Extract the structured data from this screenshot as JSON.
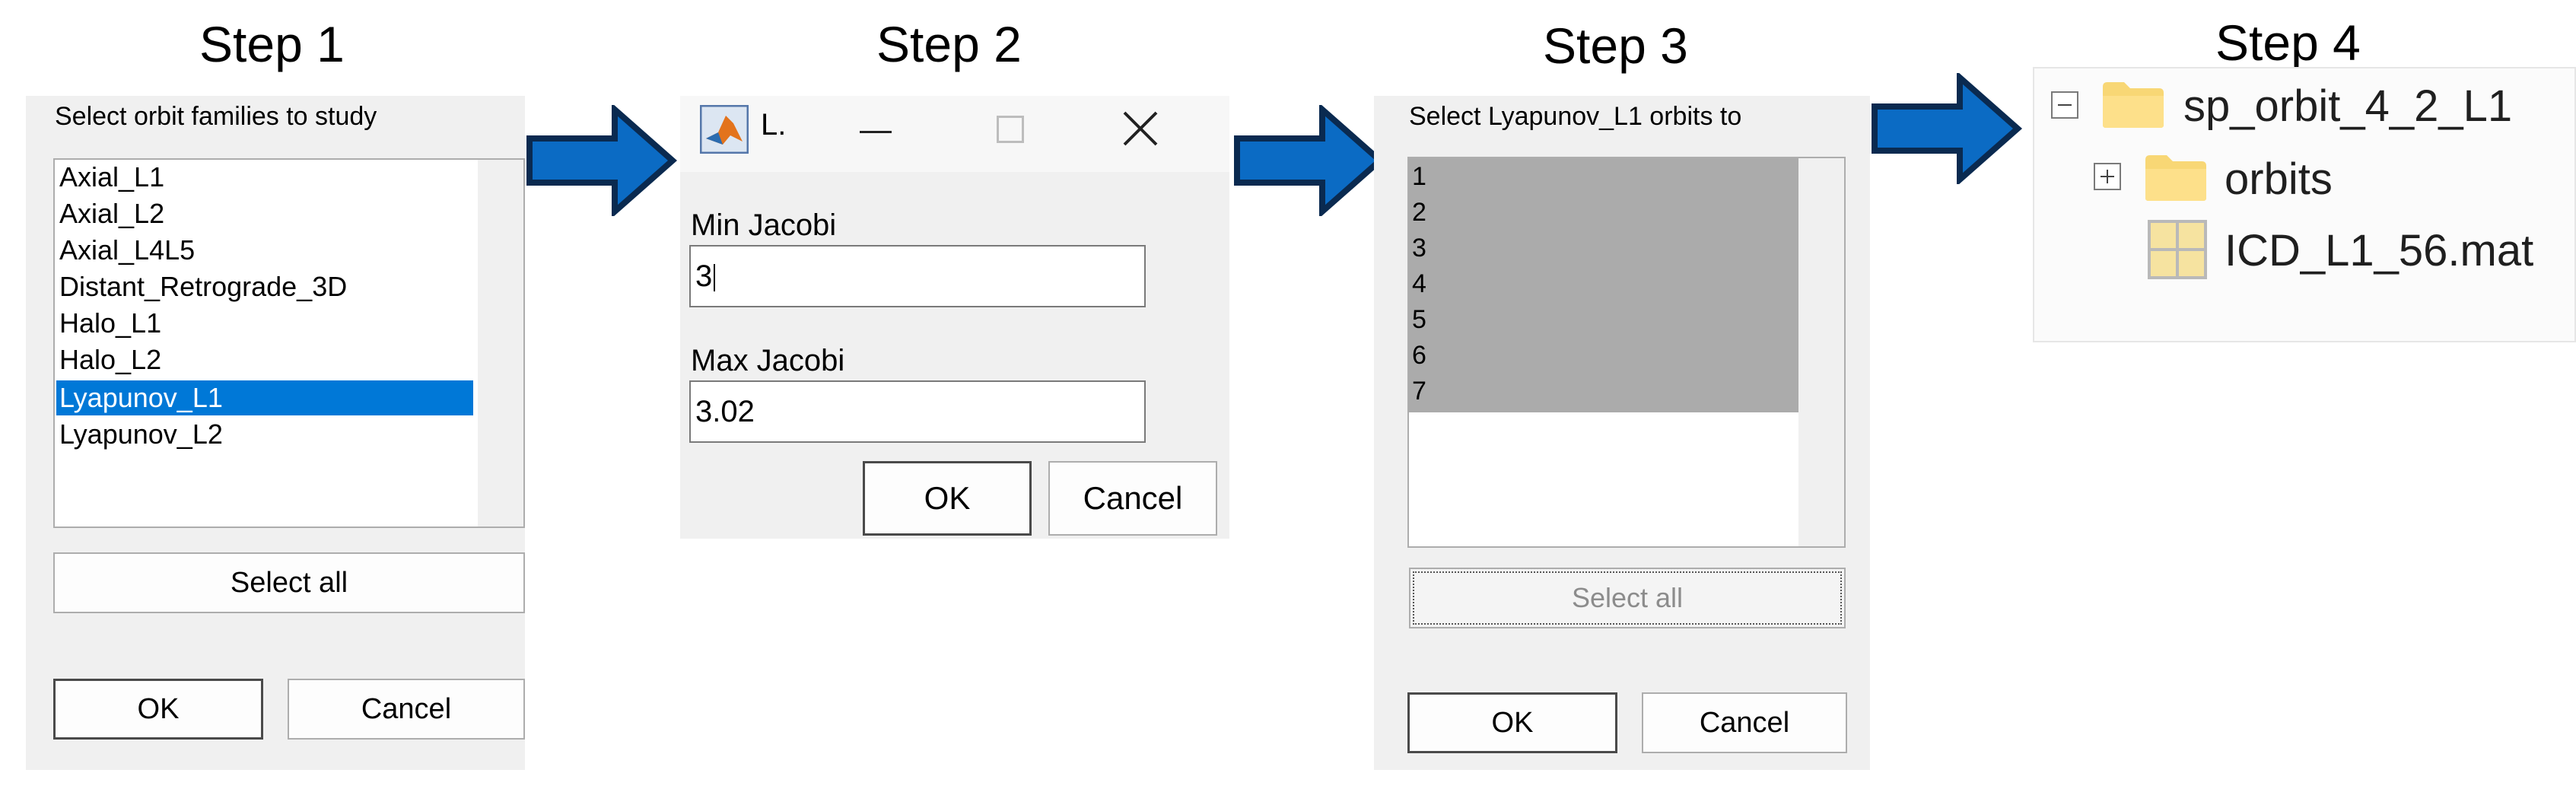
{
  "steps": [
    "Step 1",
    "Step 2",
    "Step 3",
    "Step 4"
  ],
  "step1": {
    "prompt": "Select orbit families to study",
    "items": [
      "Axial_L1",
      "Axial_L2",
      "Axial_L4L5",
      "Distant_Retrograde_3D",
      "Halo_L1",
      "Halo_L2",
      "Lyapunov_L1",
      "Lyapunov_L2"
    ],
    "selected_index": 6,
    "select_all": "Select all",
    "ok": "OK",
    "cancel": "Cancel"
  },
  "step2": {
    "title": "L.",
    "min_label": "Min Jacobi",
    "min_value": "3",
    "max_label": "Max Jacobi",
    "max_value": "3.02",
    "ok": "OK",
    "cancel": "Cancel"
  },
  "step3": {
    "prompt": "Select Lyapunov_L1 orbits to",
    "items": [
      "1",
      "2",
      "3",
      "4",
      "5",
      "6",
      "7"
    ],
    "select_all": "Select all",
    "ok": "OK",
    "cancel": "Cancel"
  },
  "step4": {
    "root": "sp_orbit_4_2_L1",
    "folder": "orbits",
    "file": "ICD_L1_56.mat"
  },
  "colors": {
    "arrow_fill": "#0b6bc4",
    "arrow_border": "#0a2a50",
    "selection": "#0078d7",
    "folder": "#fde08a"
  }
}
